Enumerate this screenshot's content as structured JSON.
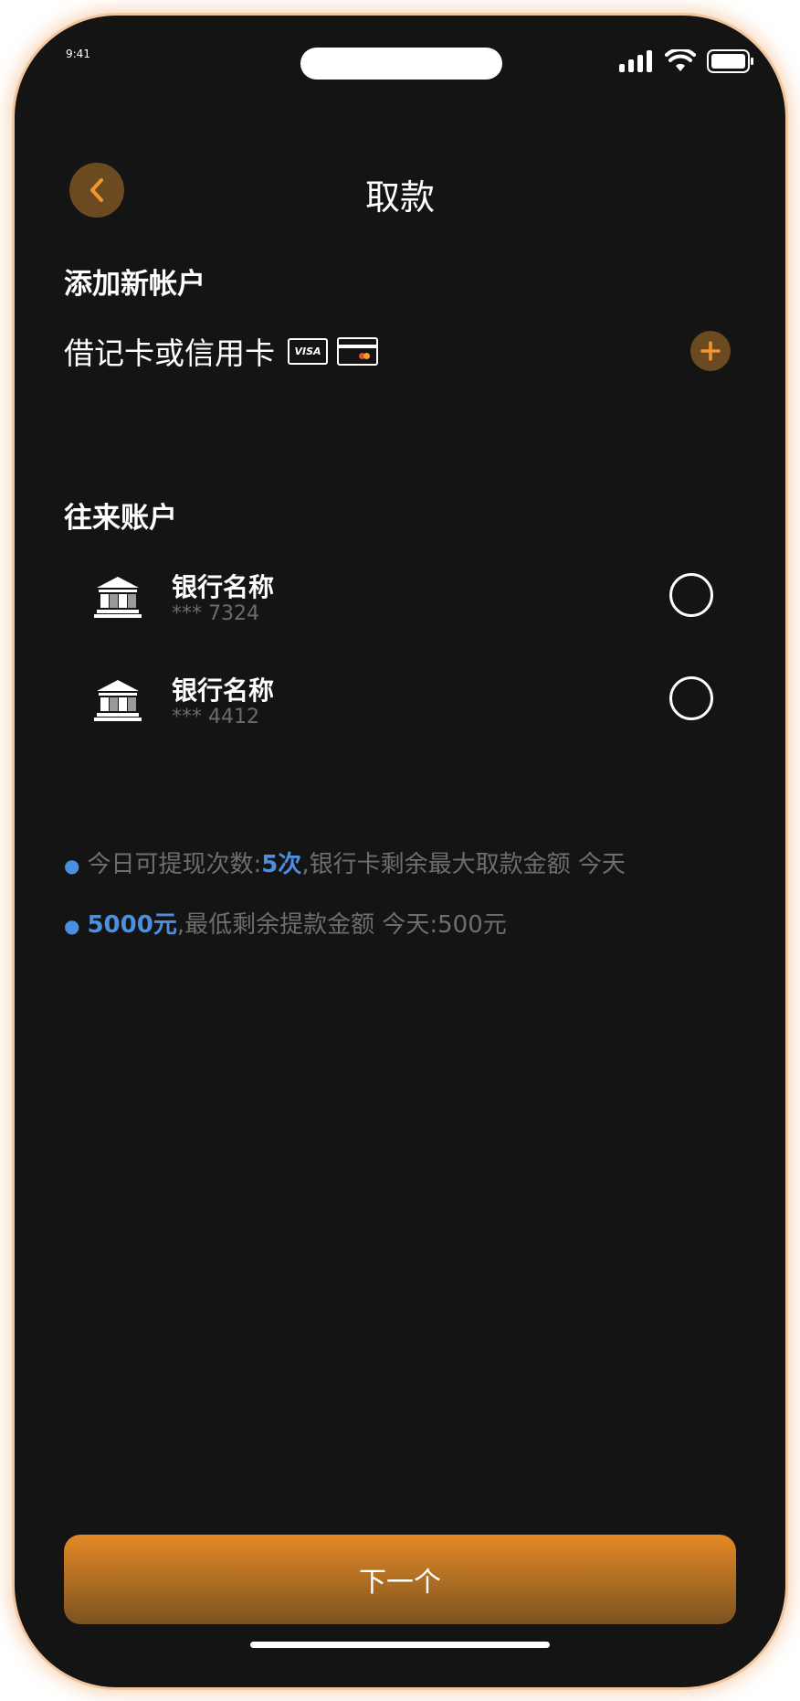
{
  "status_bar": {
    "time": "9:41"
  },
  "header": {
    "title": "取款",
    "back_icon": "chevron-left-icon"
  },
  "add_account": {
    "section_title": "添加新帐户",
    "card_label": "借记卡或信用卡",
    "visa_text": "VISA",
    "add_icon": "plus-icon"
  },
  "accounts": {
    "section_title": "往来账户",
    "items": [
      {
        "name": "银行名称",
        "number": "*** 7324",
        "icon": "bank-icon"
      },
      {
        "name": "银行名称",
        "number": "*** 4412",
        "icon": "bank-icon"
      }
    ]
  },
  "info": {
    "line1_prefix": "今日可提现次数:",
    "line1_count": "5次",
    "line1_suffix": ",银行卡剩余最大取款金额 今天",
    "line2_amount": "5000元",
    "line2_suffix": ",最低剩余提款金额 今天:500元"
  },
  "footer": {
    "next_label": "下一个"
  },
  "colors": {
    "accent": "#e48a26",
    "highlight": "#4a8fe0",
    "background": "#141414"
  }
}
